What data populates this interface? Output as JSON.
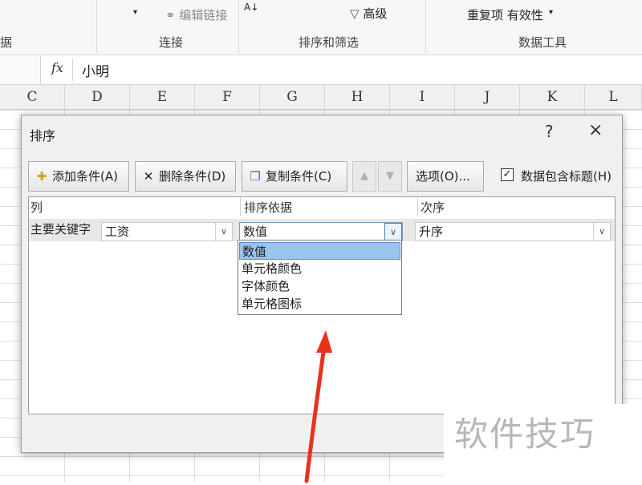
{
  "ribbon": {
    "edit_links": "编辑链接",
    "advanced": "高级",
    "duplicates_validity": "重复项 有效性",
    "group_get_data_partial": "据",
    "group_connections": "连接",
    "group_sort_filter": "排序和筛选",
    "group_data_tools": "数据工具"
  },
  "formula_bar": {
    "fx_label": "fx",
    "value": "小明"
  },
  "columns": [
    "C",
    "D",
    "E",
    "F",
    "G",
    "H",
    "I",
    "J",
    "K",
    "L"
  ],
  "dialog": {
    "title": "排序",
    "help": "?",
    "close": "×",
    "toolbar": {
      "add_condition": "添加条件(A)",
      "delete_condition": "删除条件(D)",
      "copy_condition": "复制条件(C)",
      "move_up": "▲",
      "move_down": "▼",
      "options": "选项(O)...",
      "has_header_label": "数据包含标题(H)",
      "has_header_checked": true
    },
    "headers": {
      "column": "列",
      "sort_on": "排序依据",
      "order": "次序"
    },
    "row": {
      "label": "主要关键字",
      "column_value": "工资",
      "sort_on_value": "数值",
      "order_value": "升序"
    },
    "sort_on_options": [
      "数值",
      "单元格颜色",
      "字体颜色",
      "单元格图标"
    ],
    "sort_on_selected_index": 0
  },
  "watermark": "软件技巧",
  "colors": {
    "selection": "#99c4ee",
    "arrow": "#e8321e"
  }
}
